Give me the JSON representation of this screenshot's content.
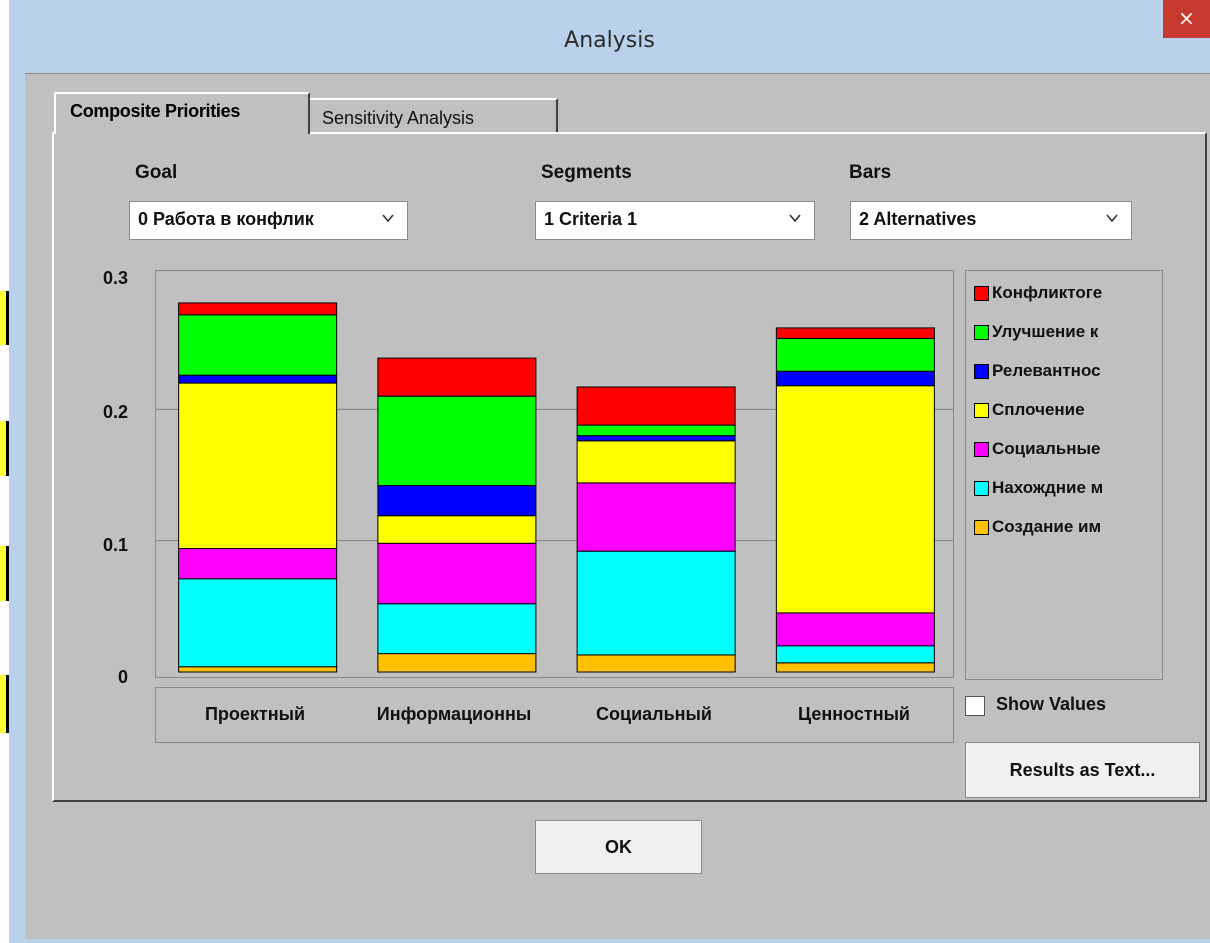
{
  "window": {
    "title": "Analysis",
    "close_glyph": "×"
  },
  "tabs": [
    {
      "label": "Composite Priorities",
      "active": true
    },
    {
      "label": "Sensitivity Analysis",
      "active": false
    }
  ],
  "controls": {
    "goal": {
      "label": "Goal",
      "value": "0 Работа в конфлик"
    },
    "segments": {
      "label": "Segments",
      "value": "1 Criteria 1"
    },
    "bars": {
      "label": "Bars",
      "value": "2 Alternatives"
    }
  },
  "chart_data": {
    "type": "bar",
    "stacked": true,
    "categories": [
      "Проектный",
      "Информационны",
      "Социальный",
      "Ценностный"
    ],
    "ylim": [
      0,
      0.3
    ],
    "yticks": [
      "0",
      "0.1",
      "0.2",
      "0.3"
    ],
    "grid": true,
    "legend_position": "right",
    "series": [
      {
        "name": "Создание им",
        "color": "#ffc000",
        "values": [
          0.004,
          0.014,
          0.013,
          0.007
        ]
      },
      {
        "name": "Нахождние м",
        "color": "#00ffff",
        "values": [
          0.067,
          0.038,
          0.079,
          0.013
        ]
      },
      {
        "name": "Социальные",
        "color": "#ff00ff",
        "values": [
          0.023,
          0.046,
          0.052,
          0.025
        ]
      },
      {
        "name": "Сплочение",
        "color": "#ffff00",
        "values": [
          0.126,
          0.021,
          0.032,
          0.173
        ]
      },
      {
        "name": "Релевантнос",
        "color": "#0000ff",
        "values": [
          0.006,
          0.023,
          0.004,
          0.011
        ]
      },
      {
        "name": "Улучшение к",
        "color": "#00ff00",
        "values": [
          0.046,
          0.068,
          0.008,
          0.025
        ]
      },
      {
        "name": "Конфликтоге",
        "color": "#ff0000",
        "values": [
          0.009,
          0.029,
          0.029,
          0.008
        ]
      }
    ]
  },
  "legend_order": [
    "Конфликтоге",
    "Улучшение к",
    "Релевантнос",
    "Сплочение",
    "Социальные",
    "Нахождние м",
    "Создание им"
  ],
  "show_values": {
    "label": "Show Values",
    "checked": false
  },
  "buttons": {
    "results": "Results as Text...",
    "ok": "OK"
  }
}
